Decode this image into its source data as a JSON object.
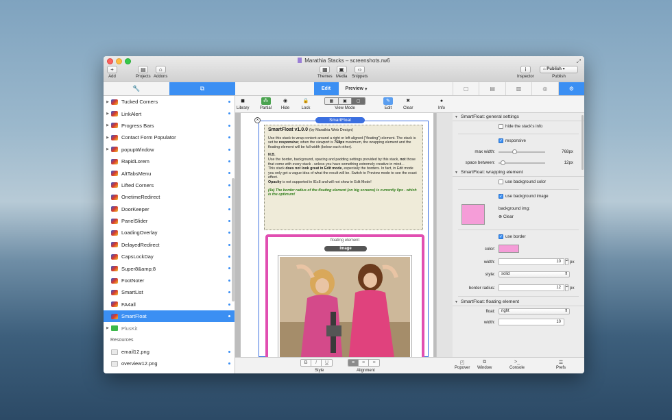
{
  "window": {
    "title": "Marathia Stacks – screenshots.rw6"
  },
  "toolbar": {
    "add": "Add",
    "projects": "Projects",
    "addons": "Addons",
    "themes": "Themes",
    "media": "Media",
    "snippets": "Snippets",
    "inspector": "Inspector",
    "publish": "Publish",
    "publish_btn": "Publish"
  },
  "tabs": {
    "edit": "Edit",
    "preview": "Preview"
  },
  "edit_tools": {
    "library": "Library",
    "partial": "Partial",
    "hide": "Hide",
    "lock": "Lock",
    "view_mode": "View Mode",
    "edit": "Edit",
    "clear": "Clear",
    "info": "Info"
  },
  "sidebar": {
    "items": [
      {
        "label": "Tucked Corners",
        "arrow": "▶"
      },
      {
        "label": "LinkAlert",
        "arrow": "▶"
      },
      {
        "label": "Progress Bars",
        "arrow": "▶"
      },
      {
        "label": "Contact Form Populator",
        "arrow": "▶"
      },
      {
        "label": "popupWindow",
        "arrow": "▶"
      },
      {
        "label": "RapidLorem",
        "arrow": ""
      },
      {
        "label": "AltTabsMenu",
        "arrow": ""
      },
      {
        "label": "Lifted Corners",
        "arrow": ""
      },
      {
        "label": "OnetimeRedirect",
        "arrow": ""
      },
      {
        "label": "DoorKeeper",
        "arrow": ""
      },
      {
        "label": "PanelSlider",
        "arrow": ""
      },
      {
        "label": "LoadingOverlay",
        "arrow": ""
      },
      {
        "label": "DelayedRedirect",
        "arrow": ""
      },
      {
        "label": "CapsLockDay",
        "arrow": ""
      },
      {
        "label": "Super8&amp;8",
        "arrow": ""
      },
      {
        "label": "FootNoter",
        "arrow": ""
      },
      {
        "label": "SmartList",
        "arrow": ""
      },
      {
        "label": "FA4all",
        "arrow": ""
      },
      {
        "label": "SmartFloat",
        "arrow": ""
      },
      {
        "label": "PlusKit",
        "arrow": "▶"
      }
    ],
    "resources_header": "Resources",
    "resources": [
      {
        "label": "email12.png"
      },
      {
        "label": "overview12.png"
      }
    ]
  },
  "canvas": {
    "stack_label": "SmartFloat",
    "note_title": "SmartFloat v1.0.0",
    "note_by": "(by Marathia Web Design)",
    "p1a": "Use this stack to wrap content around a right or left aligned (\"floating\") element. The stack is set be ",
    "p1b": "responsive",
    "p1c": "; when the viewport is ",
    "p1d": "768px",
    "p1e": " maximum, the wrapping element and the floating element will be full width (below each other).",
    "nb": "N.B.",
    "p2a": "Use the border, background, spacing and padding settings provided by this stack, ",
    "p2b": "not",
    "p2c": " those that come with every stack - unless you have something extremely creative in mind...",
    "p3a": "This stack ",
    "p3b": "does not look great in Edit mode",
    "p3c": ", especially the borders. In fact, in Edit mode you only get a vague idea of what the result will be. Switch to Preview mode to see the exact effect.",
    "p4a": "Opacity",
    "p4b": " is not supported in IE≤8 and will not show in Edit Mode!",
    "p5": "(4a) The border radius of the floating element (on big screens) is currently 0px - which is the optimum!",
    "floating_label": "floating element",
    "image_label": "Image"
  },
  "bottom": {
    "style": "Style",
    "alignment": "Alignment",
    "bold": "B",
    "italic": "I",
    "underline": "U"
  },
  "inspector": {
    "sec1": "SmartFloat: general settings",
    "hide_info": "hide the stack's info",
    "responsive": "responsive",
    "max_width_label": "max width:",
    "max_width_val": "768px",
    "max_width_frac": 0.32,
    "space_label": "space between:",
    "space_val": "12px",
    "space_frac": 0.05,
    "sec2": "SmartFloat: wrapping element",
    "use_bg_color": "use background color",
    "use_bg_img": "use background image",
    "bg_img_label": "background img:",
    "clear": "Clear",
    "use_border": "use border",
    "color_label": "color:",
    "border_color": "#f59dd8",
    "width_label": "width:",
    "width_val": "10",
    "px1": "px",
    "style_label": "style:",
    "style_val": "solid",
    "radius_label": "border radius:",
    "radius_val": "12",
    "px2": "px",
    "sec3": "SmartFloat: floating element",
    "float_label": "float:",
    "float_val": "right",
    "width2_label": "width:",
    "width2_val": "10"
  },
  "rbottom": {
    "popover": "Popover",
    "window": "Window",
    "console": "Console",
    "prefs": "Prefs"
  },
  "colors": {
    "accent": "#3b8ff3",
    "pink_border": "#e14eb1",
    "stack_blue": "#3b6fe0"
  }
}
